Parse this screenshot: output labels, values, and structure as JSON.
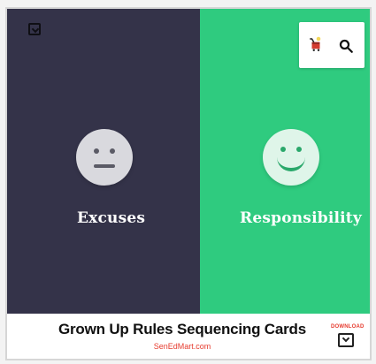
{
  "panels": {
    "left": {
      "label": "Excuses",
      "color": "#343349"
    },
    "right": {
      "label": "Responsibility",
      "color": "#2fcb7f"
    }
  },
  "toolbar": {
    "icons": [
      "download-icon",
      "cart-icon",
      "search-icon"
    ]
  },
  "footer": {
    "title": "Grown Up Rules Sequencing Cards",
    "site": "SenEdMart.com",
    "download_label": "DOWNLOAD"
  },
  "colors": {
    "accent_red": "#e63b2e",
    "dark_panel": "#343349",
    "green_panel": "#2fcb7f"
  }
}
